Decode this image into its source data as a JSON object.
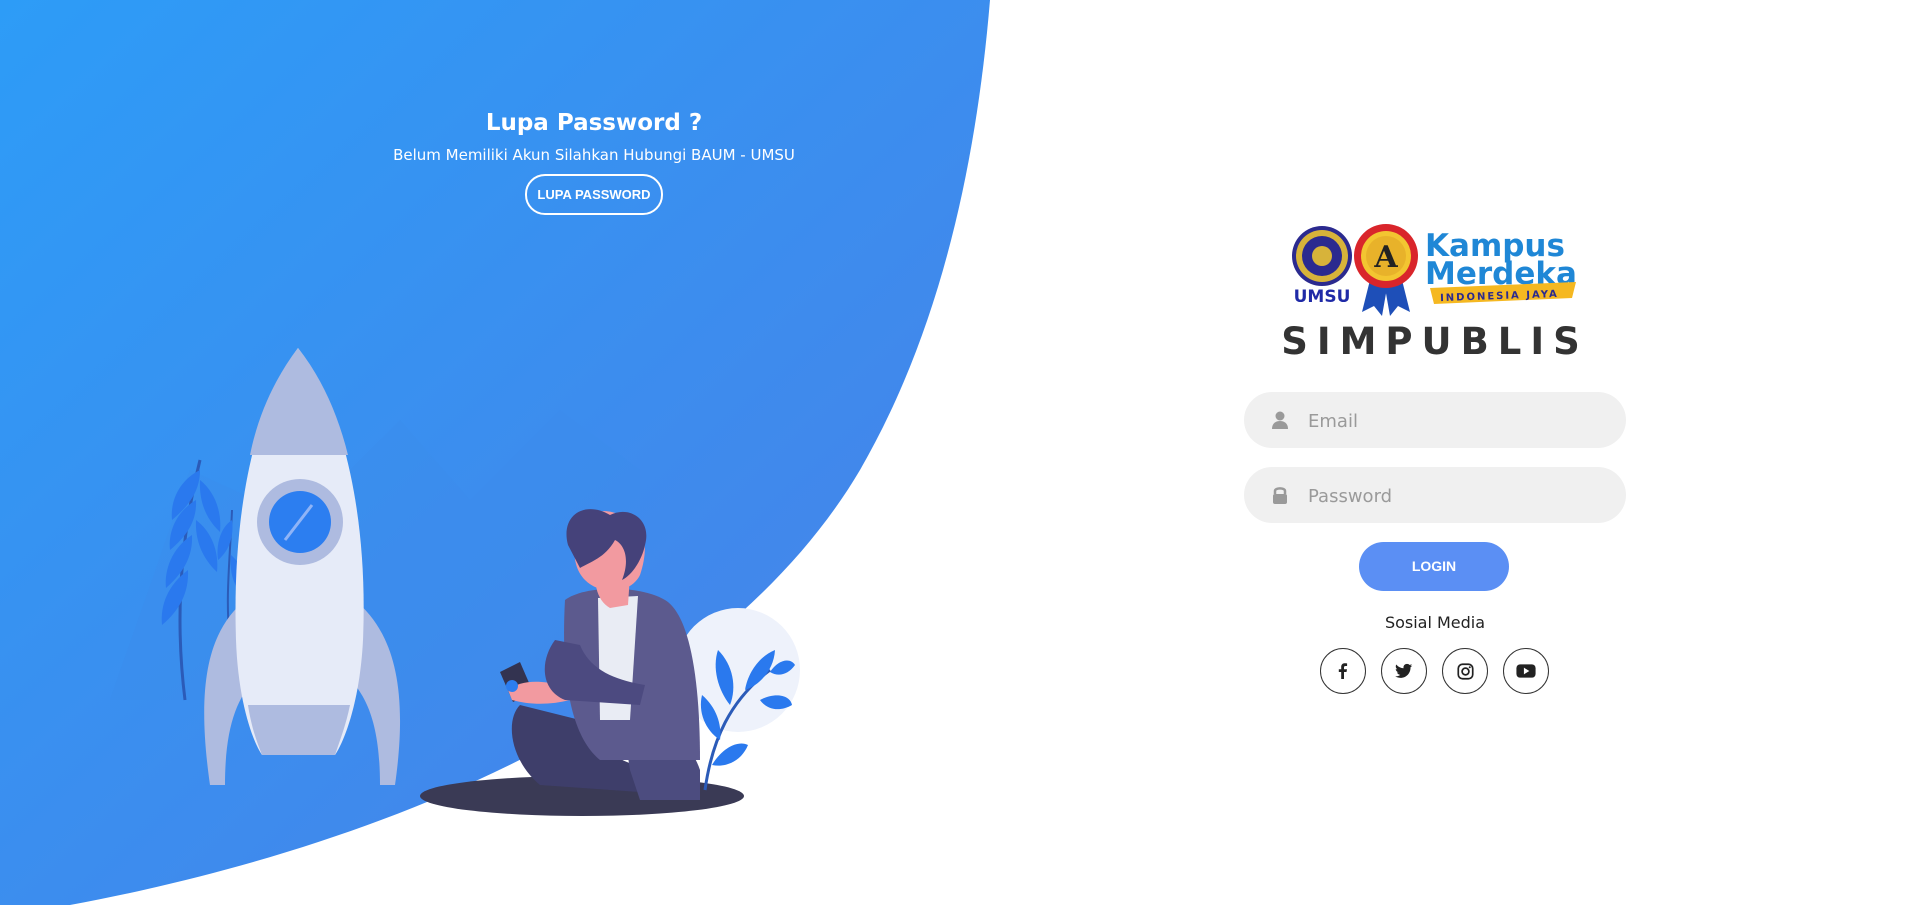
{
  "left_panel": {
    "title": "Lupa Password ?",
    "subtitle": "Belum Memiliki Akun Silahkan Hubungi BAUM - UMSU",
    "button_label": "LUPA PASSWORD"
  },
  "logos": {
    "umsu_text": "UMSU",
    "kampus_line1": "Kampus",
    "kampus_line2": "Merdeka",
    "kampus_tagline": "INDONESIA JAYA"
  },
  "app_title": "SIMPUBLIS",
  "form": {
    "email_placeholder": "Email",
    "email_value": "",
    "password_placeholder": "Password",
    "password_value": "",
    "login_label": "LOGIN"
  },
  "social": {
    "label": "Sosial Media",
    "items": [
      "facebook-icon",
      "twitter-icon",
      "instagram-icon",
      "youtube-icon"
    ]
  },
  "colors": {
    "blue_light": "#2f9af5",
    "blue_dark": "#3f83ea",
    "login_button": "#5b8ff4",
    "field_bg": "#f0f0f0",
    "title_text": "#333333"
  }
}
